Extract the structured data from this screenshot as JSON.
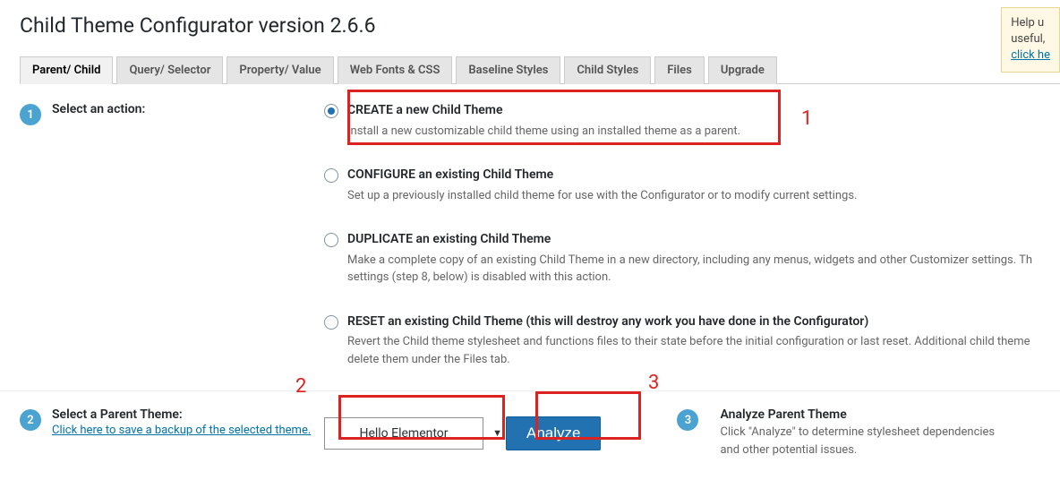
{
  "page_title": "Child Theme Configurator version 2.6.6",
  "help": {
    "line1": "Help u",
    "line2": "useful,",
    "link": "click he"
  },
  "tabs": [
    "Parent/ Child",
    "Query/ Selector",
    "Property/ Value",
    "Web Fonts & CSS",
    "Baseline Styles",
    "Child Styles",
    "Files",
    "Upgrade"
  ],
  "step1": {
    "num": "1",
    "label": "Select an action:",
    "options": [
      {
        "title": "CREATE a new Child Theme",
        "desc": "Install a new customizable child theme using an installed theme as a parent."
      },
      {
        "title": "CONFIGURE an existing Child Theme",
        "desc": "Set up a previously installed child theme for use with the Configurator or to modify current settings."
      },
      {
        "title": "DUPLICATE an existing Child Theme",
        "desc": "Make a complete copy of an existing Child Theme in a new directory, including any menus, widgets and other Customizer settings. Th settings (step 8, below) is disabled with this action."
      },
      {
        "title": "RESET an existing Child Theme (this will destroy any work you have done in the Configurator)",
        "desc": "Revert the Child theme stylesheet and functions files to their state before the initial configuration or last reset. Additional child theme delete them under the Files tab."
      }
    ]
  },
  "step2": {
    "num": "2",
    "label": "Select a Parent Theme:",
    "sublink": "Click here to save a backup of the selected theme.",
    "dropdown_value": "Hello Elementor",
    "analyze_button": "Analyze"
  },
  "step3": {
    "num": "3",
    "title": "Analyze Parent Theme",
    "desc": "Click \"Analyze\" to determine stylesheet dependencies and other potential issues."
  },
  "annotations": {
    "a1": "1",
    "a2": "2",
    "a3": "3"
  }
}
